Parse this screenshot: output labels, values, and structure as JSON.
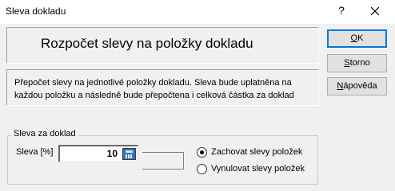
{
  "window": {
    "title": "Sleva dokladu",
    "help_glyph": "?",
    "close_icon": "close-icon"
  },
  "header": {
    "title": "Rozpočet slevy na položky dokladu"
  },
  "description": {
    "text": "Přepočet slevy na jednotlivé položky dokladu. Sleva bude uplatněna na každou položku a následně bude přepočtena i celková částka za doklad"
  },
  "discount_group": {
    "label": "Sleva za doklad",
    "field_label": "Sleva [%]",
    "value": "10",
    "calculator_icon": "calculator-icon",
    "options": [
      {
        "label": "Zachovat slevy položek",
        "selected": true
      },
      {
        "label": "Vynulovat slevy položek",
        "selected": false
      }
    ]
  },
  "buttons": {
    "ok": "OK",
    "storno": "Storno",
    "help": "Nápověda"
  },
  "colors": {
    "focus_border": "#0078d7",
    "window_bg": "#f0f0f0"
  }
}
